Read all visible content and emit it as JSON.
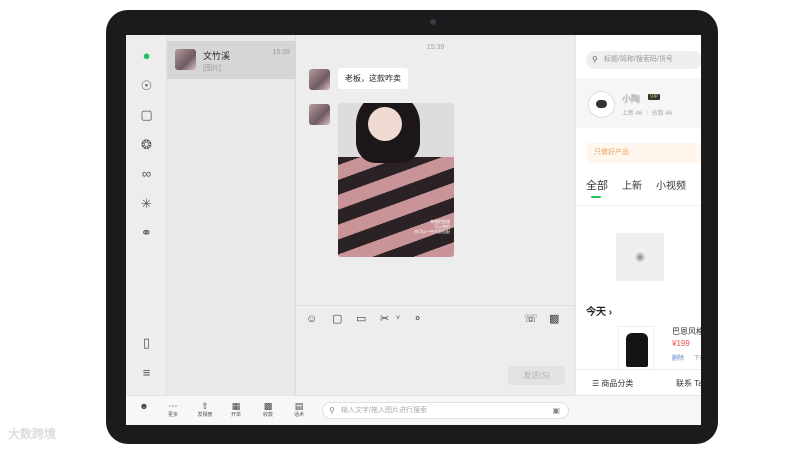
{
  "chat_list": [
    {
      "name": "文竹溪",
      "time": "15:39",
      "preview": "[图片]"
    }
  ],
  "chat": {
    "timestamp": "15:39",
    "messages": [
      {
        "type": "text",
        "text": "老板，这款咋卖"
      },
      {
        "type": "image",
        "overlay_text": [
          "单独拍链接",
          "可以单拍",
          "也可以一件代发搭配"
        ]
      }
    ],
    "send_label": "发送(S)"
  },
  "store": {
    "search_placeholder": "标题/简称/搜索码/货号",
    "shop_name": "小陶",
    "vip_badge": "VIP",
    "stats": "上新 46 ｜ 总数 46",
    "slogan": "只做好产品",
    "tabs": [
      "全部",
      "上新",
      "小视频"
    ],
    "today_label": "今天 ›",
    "product": {
      "name": "巴恩风格",
      "price": "¥199",
      "actions": [
        "删除",
        "下载"
      ]
    },
    "bottom_tabs": [
      "☰ 商品分类",
      "联系 Ta"
    ]
  },
  "bottom_bar": {
    "items": [
      {
        "icon": "more-icon",
        "label": "更多"
      },
      {
        "icon": "share-icon",
        "label": "发相册"
      },
      {
        "icon": "order-icon",
        "label": "开单"
      },
      {
        "icon": "qr-icon",
        "label": "收款"
      },
      {
        "icon": "talk-icon",
        "label": "话术"
      }
    ],
    "input_placeholder": "输入文字/拖入图片进行搜索"
  },
  "watermark": "大数跨境",
  "colors": {
    "accent": "#25c160",
    "price": "#f04a4a",
    "slogan": "#e5a45b"
  }
}
